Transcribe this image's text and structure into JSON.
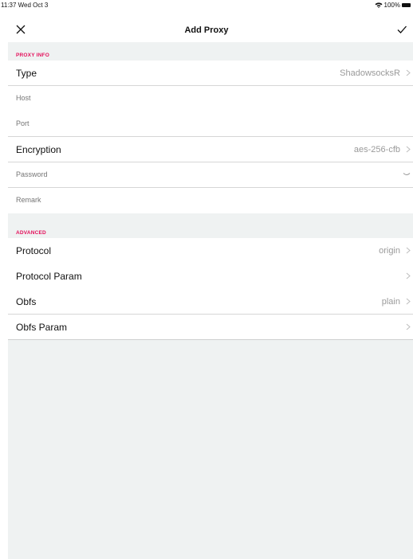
{
  "status": {
    "time": "11:37  Wed Oct 3",
    "battery": "100%"
  },
  "nav": {
    "title": "Add Proxy"
  },
  "sections": {
    "proxy_info": {
      "header": "PROXY INFO",
      "type_label": "Type",
      "type_value": "ShadowsocksR",
      "host_placeholder": "Host",
      "port_placeholder": "Port",
      "encryption_label": "Encryption",
      "encryption_value": "aes-256-cfb",
      "password_placeholder": "Password",
      "remark_placeholder": "Remark"
    },
    "advanced": {
      "header": "ADVANCED",
      "protocol_label": "Protocol",
      "protocol_value": "origin",
      "protocol_param_label": "Protocol Param",
      "obfs_label": "Obfs",
      "obfs_value": "plain",
      "obfs_param_label": "Obfs Param"
    }
  },
  "colors": {
    "accent": "#e4105b",
    "background": "#eff2f2",
    "value_text": "#9a9a9a",
    "placeholder": "#c4c4c4"
  }
}
